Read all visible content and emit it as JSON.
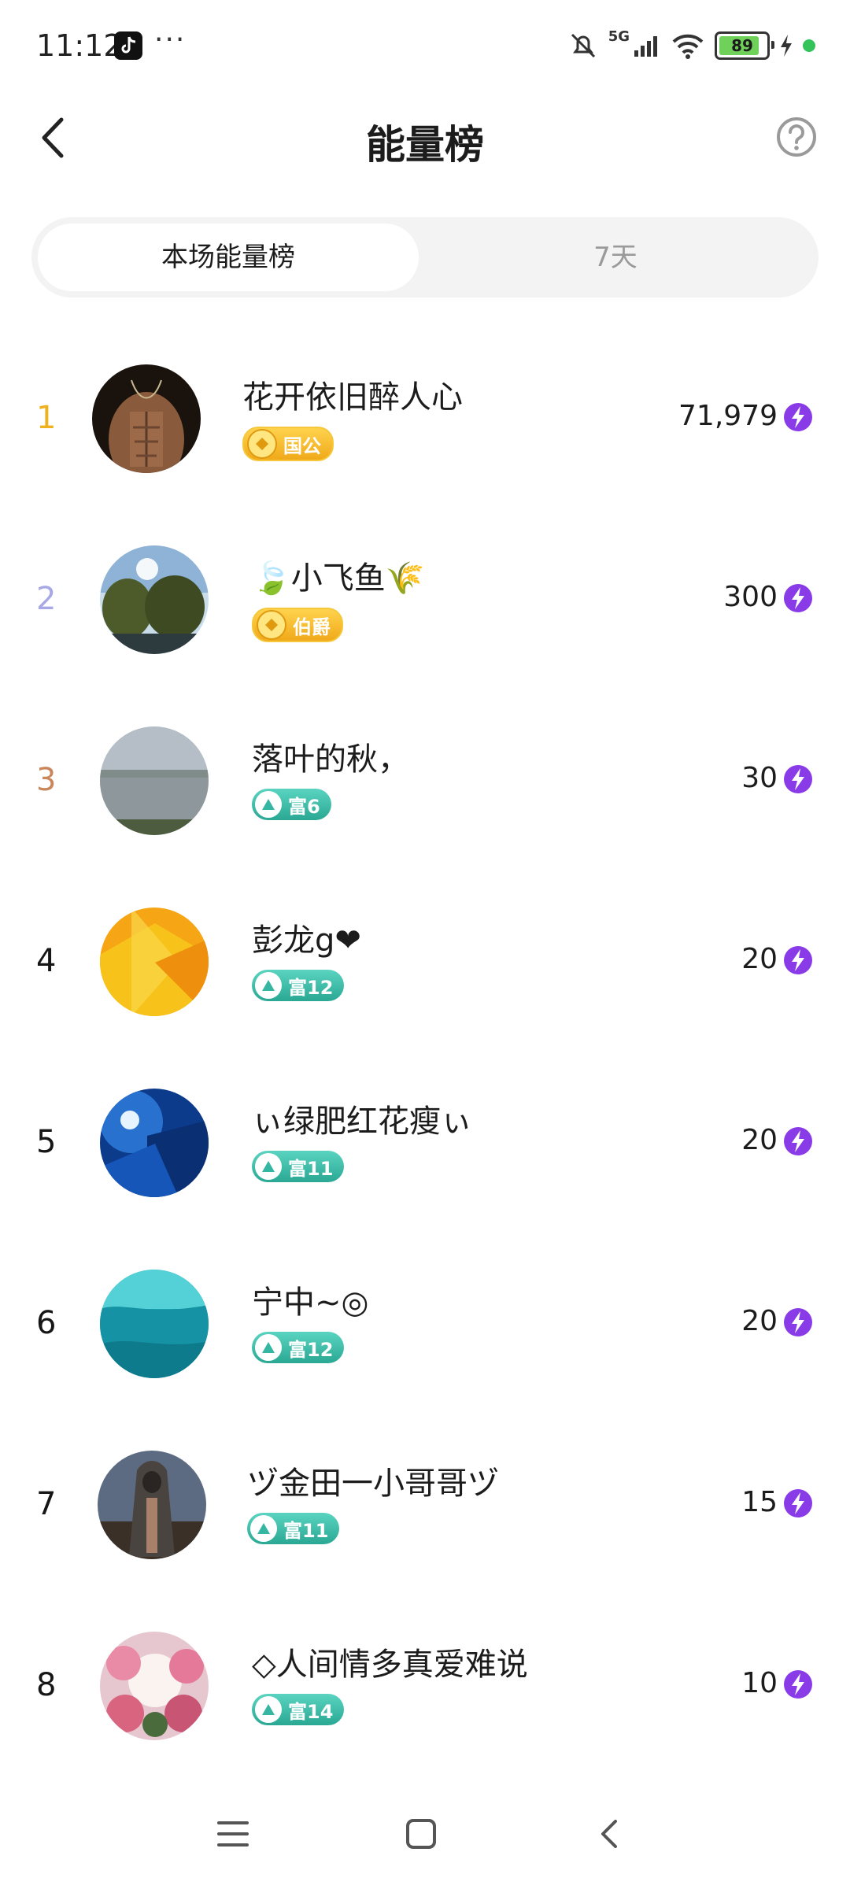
{
  "status_bar": {
    "time": "11:12",
    "more": "···",
    "network": "5G",
    "battery": "89",
    "icons": [
      "tiktok-icon",
      "mute-icon",
      "signal-icon",
      "wifi-icon",
      "battery-icon",
      "charging-icon"
    ]
  },
  "header": {
    "title": "能量榜",
    "back_icon": "chevron-left-icon",
    "help_icon": "question-circle-icon"
  },
  "tabs": [
    {
      "label": "本场能量榜",
      "active": true
    },
    {
      "label": "7天",
      "active": false
    }
  ],
  "colors": {
    "rank1": "#f0b21c",
    "rank2": "#a9a8e6",
    "rank3": "#c9865b",
    "rank_default": "#1c1c1c",
    "energy": "#8a3be8",
    "badge_gold": "#f4b62a",
    "badge_teal": "#35b6a2"
  },
  "ranking": [
    {
      "rank": "1",
      "name": "花开依旧醉人心",
      "badge": "国公",
      "badge_type": "gold",
      "score": "71,979"
    },
    {
      "rank": "2",
      "name": "🍃小飞鱼🌾",
      "badge": "伯爵",
      "badge_type": "gold",
      "score": "300"
    },
    {
      "rank": "3",
      "name": "落叶的秋，",
      "badge": "富6",
      "badge_type": "teal",
      "score": "30"
    },
    {
      "rank": "4",
      "name": "彭龙g❤",
      "badge": "富12",
      "badge_type": "teal",
      "score": "20"
    },
    {
      "rank": "5",
      "name": "ぃ绿肥红花瘦ぃ",
      "badge": "富11",
      "badge_type": "teal",
      "score": "20"
    },
    {
      "rank": "6",
      "name": "宁中~◎",
      "badge": "富12",
      "badge_type": "teal",
      "score": "20"
    },
    {
      "rank": "7",
      "name": "ヅ金田一小哥哥ヅ",
      "badge": "富11",
      "badge_type": "teal",
      "score": "15"
    },
    {
      "rank": "8",
      "name": "◇人间情多真爱难说",
      "badge": "富14",
      "badge_type": "teal",
      "score": "10"
    }
  ],
  "nav": {
    "menu_icon": "menu-icon",
    "home_icon": "home-square-icon",
    "back_icon": "back-chevron-icon"
  }
}
